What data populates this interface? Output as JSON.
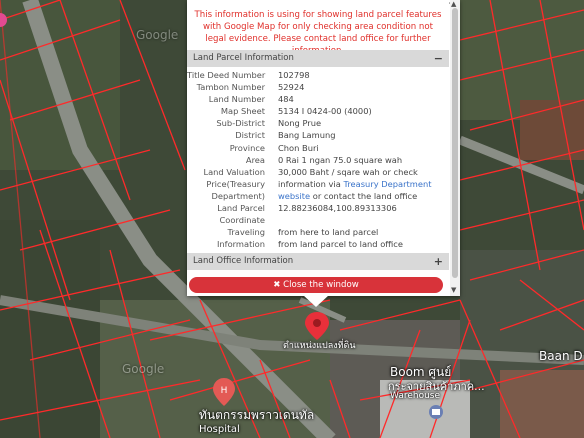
{
  "map": {
    "marker_label": "ตำแหน่งแปลงที่ดิน",
    "poi_boom_line1": "Boom ศูนย์",
    "poi_boom_line2": "กระจายสินค้าภาค...",
    "poi_boom_line3": "Warehouse",
    "poi_baan": "Baan D",
    "poi_hospital_line1": "ทันตกรรมพราวเดนทัล",
    "poi_hospital_line2": "Hospital",
    "google_watermark_top": "Google",
    "google_watermark_bottom": "Google",
    "marker_color": "#e8303a",
    "parcel_line_color": "#ff2a2a"
  },
  "popup": {
    "close_x": "×",
    "disclaimer": "This information is using for showing land parcel features with Google Map for only checking area condition not legal evidence. Please contact land office for further information.",
    "section_parcel": "Land Parcel Information",
    "section_parcel_toggle": "−",
    "section_office": "Land Office Information",
    "section_office_toggle": "+",
    "close_button": "✖ Close the window",
    "rows": [
      {
        "label": "Title Deed Number",
        "value": "102798"
      },
      {
        "label": "Tambon Number",
        "value": "52924"
      },
      {
        "label": "Land Number",
        "value": "484"
      },
      {
        "label": "Map Sheet",
        "value": "5134 I 0424-00 (4000)"
      },
      {
        "label": "Sub-District",
        "value": "Nong Prue"
      },
      {
        "label": "District",
        "value": "Bang Lamung"
      },
      {
        "label": "Province",
        "value": "Chon Buri"
      },
      {
        "label": "Area",
        "value": "0 Rai 1 ngan 75.0 square wah"
      },
      {
        "label": "Land Valuation",
        "value": "30,000 Baht / sqare wah or check"
      },
      {
        "label": "Price(Treasury",
        "value_pre": "information via ",
        "value_link": "Treasury Department"
      },
      {
        "label": "Department)",
        "value_link": "website",
        "value_post": " or contact the land office"
      },
      {
        "label": "Land Parcel",
        "value_link": "12.88236084,100.89313306"
      },
      {
        "label": "Coordinate",
        "value": ""
      },
      {
        "label": "Traveling",
        "value_link": "from here to land parcel"
      },
      {
        "label": "Information",
        "value_link": "from land parcel to land office"
      }
    ]
  }
}
